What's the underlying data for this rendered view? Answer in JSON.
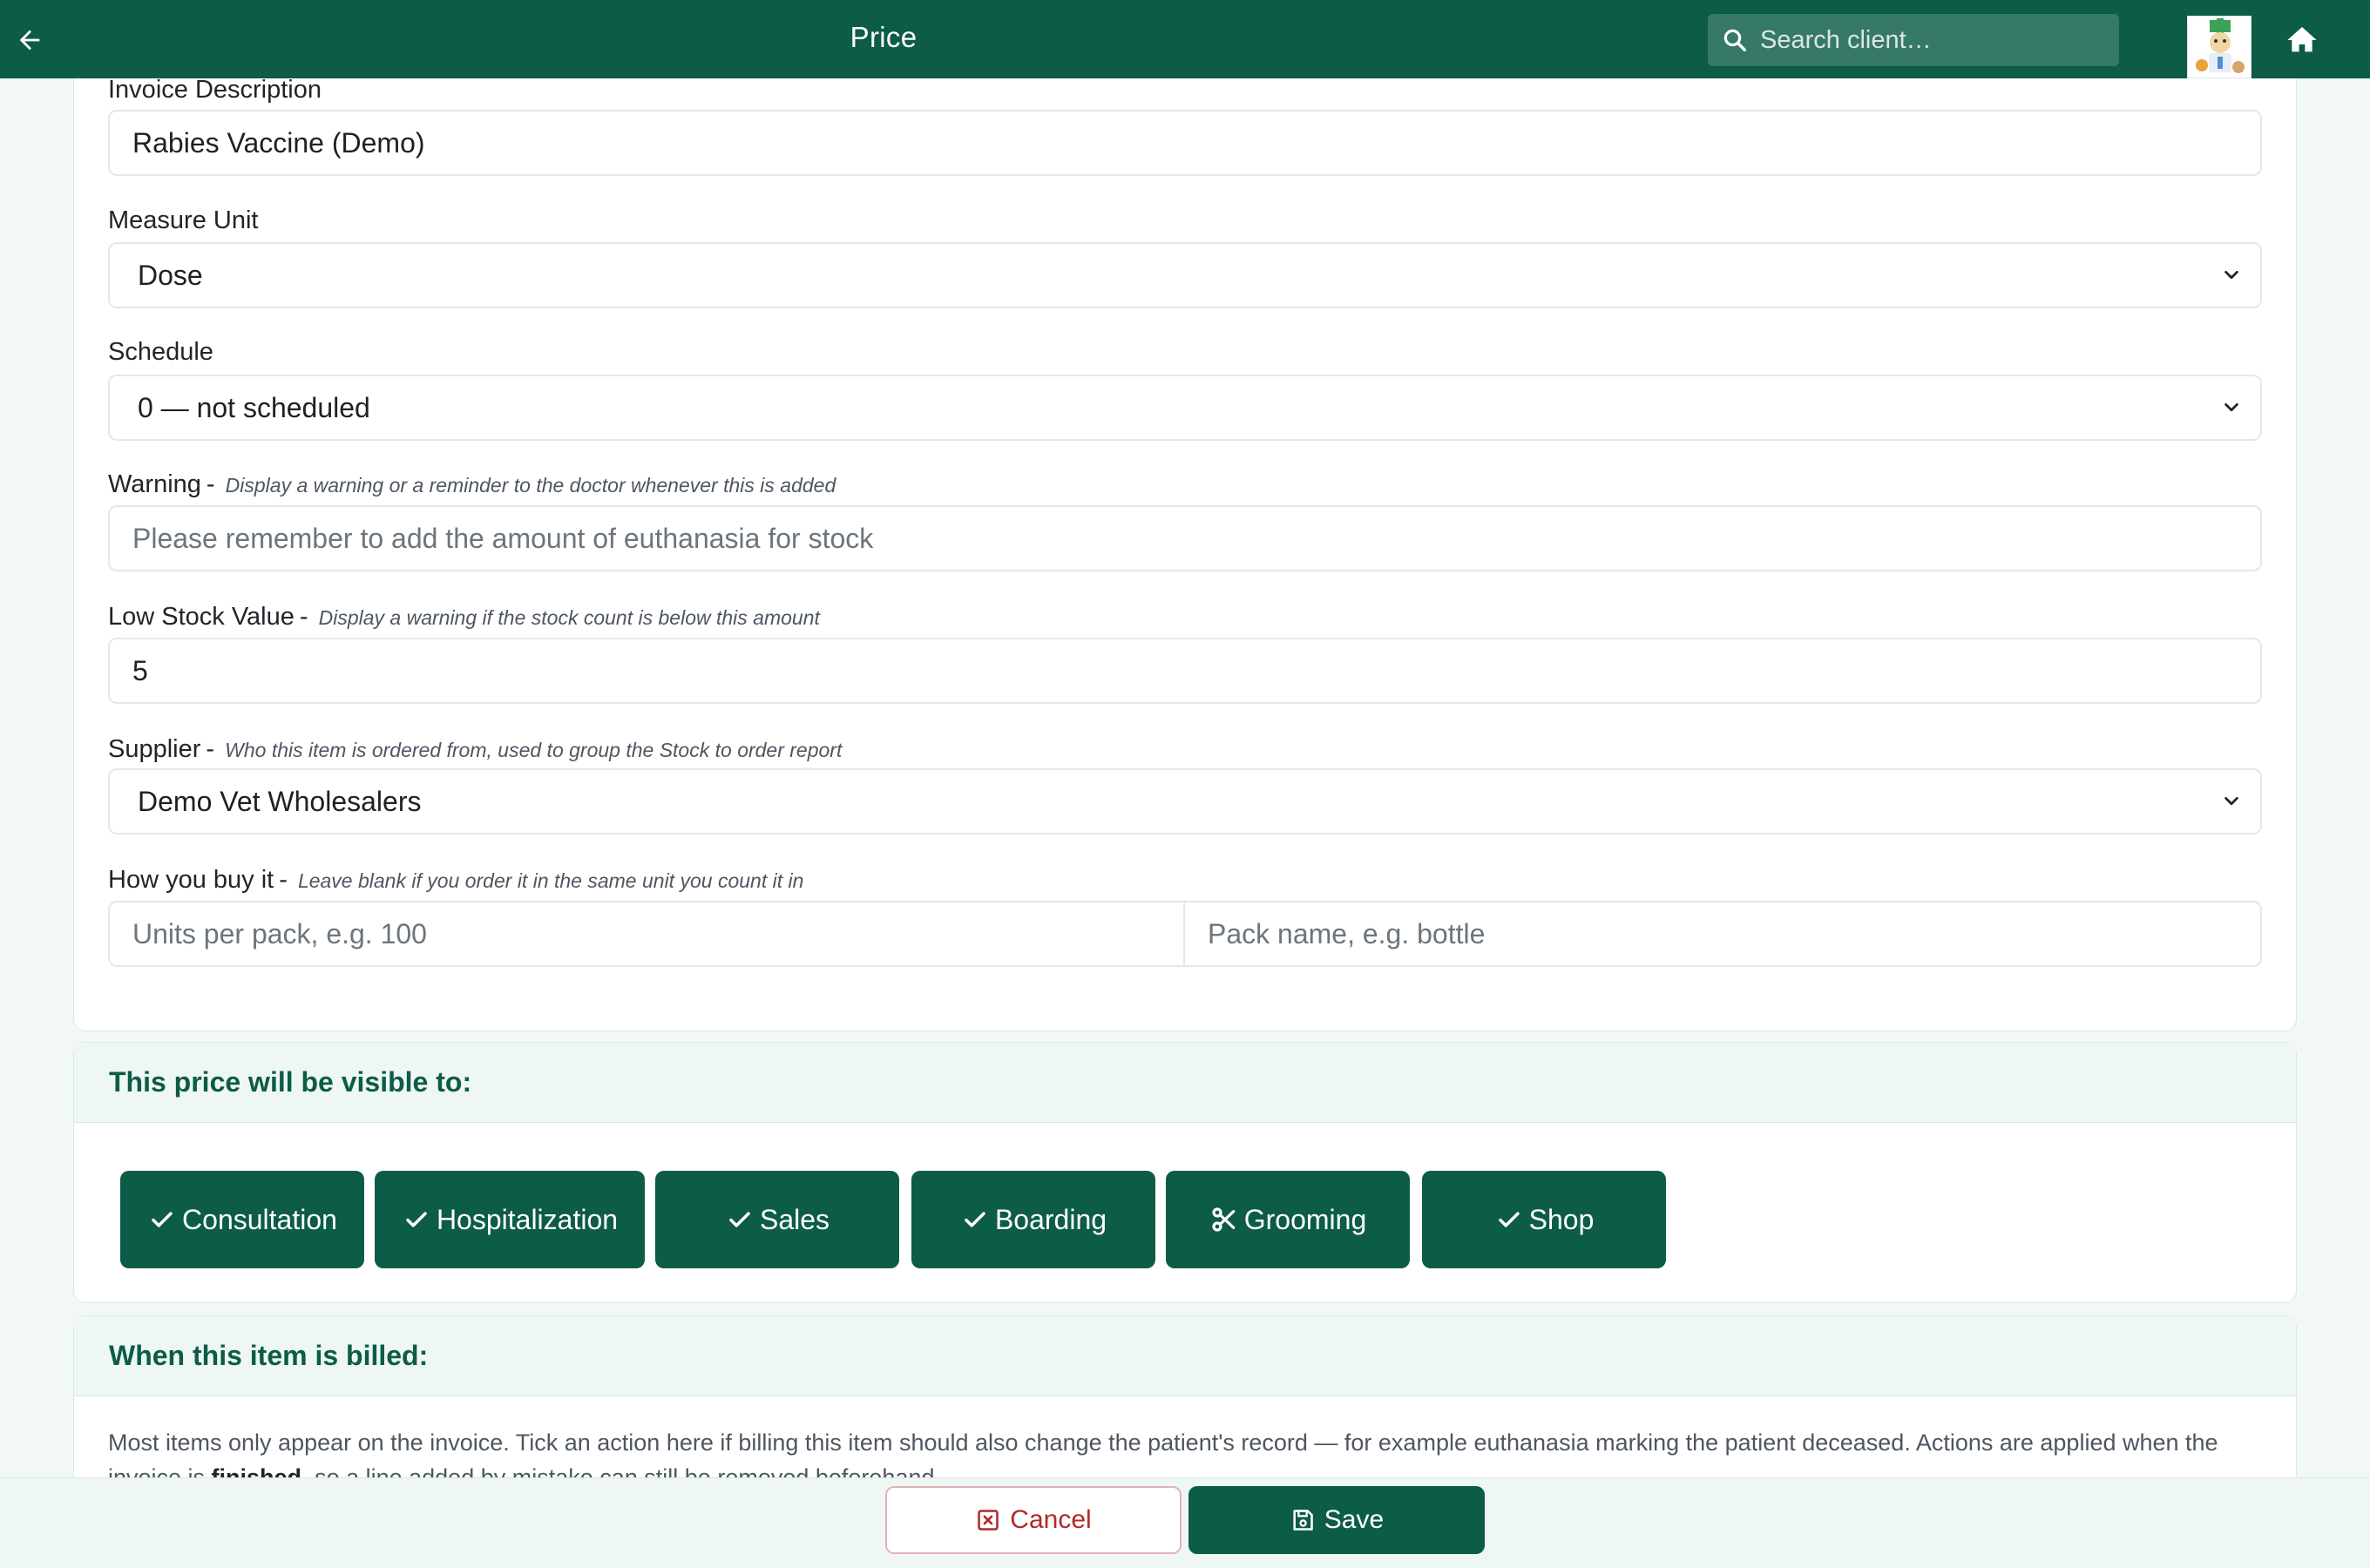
{
  "header": {
    "title": "Price",
    "search_placeholder": "Search client…",
    "icons": [
      "arrow-left-icon",
      "search-icon",
      "avatar",
      "home-icon"
    ],
    "bg_color": "#0c5c47"
  },
  "form": {
    "invoice_description": {
      "label": "Invoice Description",
      "value": "Rabies Vaccine (Demo)"
    },
    "measure_unit": {
      "label": "Measure Unit",
      "value": "Dose"
    },
    "schedule": {
      "label": "Schedule",
      "value": "0 — not scheduled"
    },
    "warning": {
      "label": "Warning",
      "sep": "-",
      "hint": "Display a warning or a reminder to the doctor whenever this is added",
      "placeholder": "Please remember to add the amount of euthanasia for stock"
    },
    "low_stock": {
      "label": "Low Stock Value",
      "sep": "-",
      "hint": "Display a warning if the stock count is below this amount",
      "value": "5"
    },
    "supplier": {
      "label": "Supplier",
      "sep": "-",
      "hint": "Who this item is ordered from, used to group the Stock to order report",
      "value": "Demo Vet Wholesalers"
    },
    "how_you_buy": {
      "label": "How you buy it",
      "sep": "-",
      "hint": "Leave blank if you order it in the same unit you count it in",
      "units_placeholder": "Units per pack, e.g. 100",
      "pack_placeholder": "Pack name, e.g. bottle"
    }
  },
  "visibility": {
    "heading": "This price will be visible to:",
    "chips": [
      {
        "label": "Consultation",
        "icon": "check-icon"
      },
      {
        "label": "Hospitalization",
        "icon": "check-icon"
      },
      {
        "label": "Sales",
        "icon": "check-icon"
      },
      {
        "label": "Boarding",
        "icon": "check-icon"
      },
      {
        "label": "Grooming",
        "icon": "scissors-icon"
      },
      {
        "label": "Shop",
        "icon": "check-icon"
      }
    ]
  },
  "billing": {
    "heading": "When this item is billed:",
    "text_before": "Most items only appear on the invoice. Tick an action here if billing this item should also change the patient's record — for example euthanasia marking the patient deceased. Actions are applied when the invoice is ",
    "text_bold": "finished",
    "text_after": ", so a line added by mistake can still be removed beforehand."
  },
  "footer": {
    "cancel_label": "Cancel",
    "save_label": "Save"
  }
}
